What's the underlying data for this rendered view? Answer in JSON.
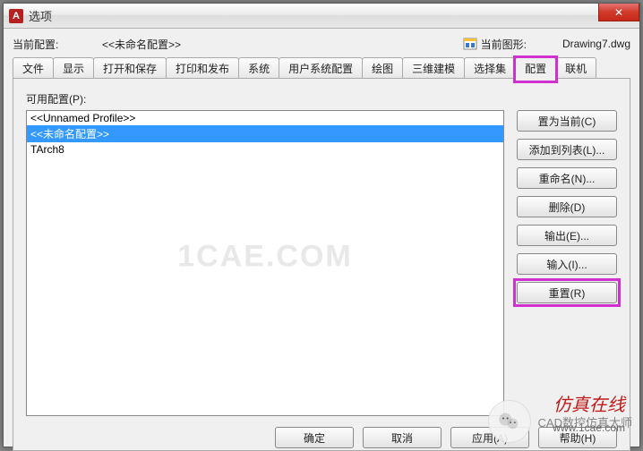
{
  "window": {
    "title": "选项",
    "close_glyph": "✕",
    "max_glyph": "▭",
    "min_glyph": "—"
  },
  "info": {
    "current_profile_label": "当前配置:",
    "current_profile_value": "<<未命名配置>>",
    "current_drawing_label": "当前图形:",
    "current_drawing_value": "Drawing7.dwg"
  },
  "tabs": {
    "items": [
      {
        "label": "文件"
      },
      {
        "label": "显示"
      },
      {
        "label": "打开和保存"
      },
      {
        "label": "打印和发布"
      },
      {
        "label": "系统"
      },
      {
        "label": "用户系统配置"
      },
      {
        "label": "绘图"
      },
      {
        "label": "三维建模"
      },
      {
        "label": "选择集"
      },
      {
        "label": "配置"
      },
      {
        "label": "联机"
      }
    ]
  },
  "panel": {
    "list_label": "可用配置(P):",
    "profiles": [
      {
        "label": "<<Unnamed Profile>>"
      },
      {
        "label": "<<未命名配置>>"
      },
      {
        "label": "TArch8"
      }
    ],
    "watermark": "1CAE.COM"
  },
  "side_buttons": {
    "set_current": "置为当前(C)",
    "add_to_list": "添加到列表(L)...",
    "rename": "重命名(N)...",
    "delete": "删除(D)",
    "export": "输出(E)...",
    "import": "输入(I)...",
    "reset": "重置(R)"
  },
  "bottom": {
    "ok": "确定",
    "cancel": "取消",
    "apply": "应用(A)",
    "help": "帮助(H)"
  },
  "footer": {
    "brand": "仿真在线",
    "url": "www.1cae.com",
    "wechat_hint": "CAD数控仿真大师"
  }
}
